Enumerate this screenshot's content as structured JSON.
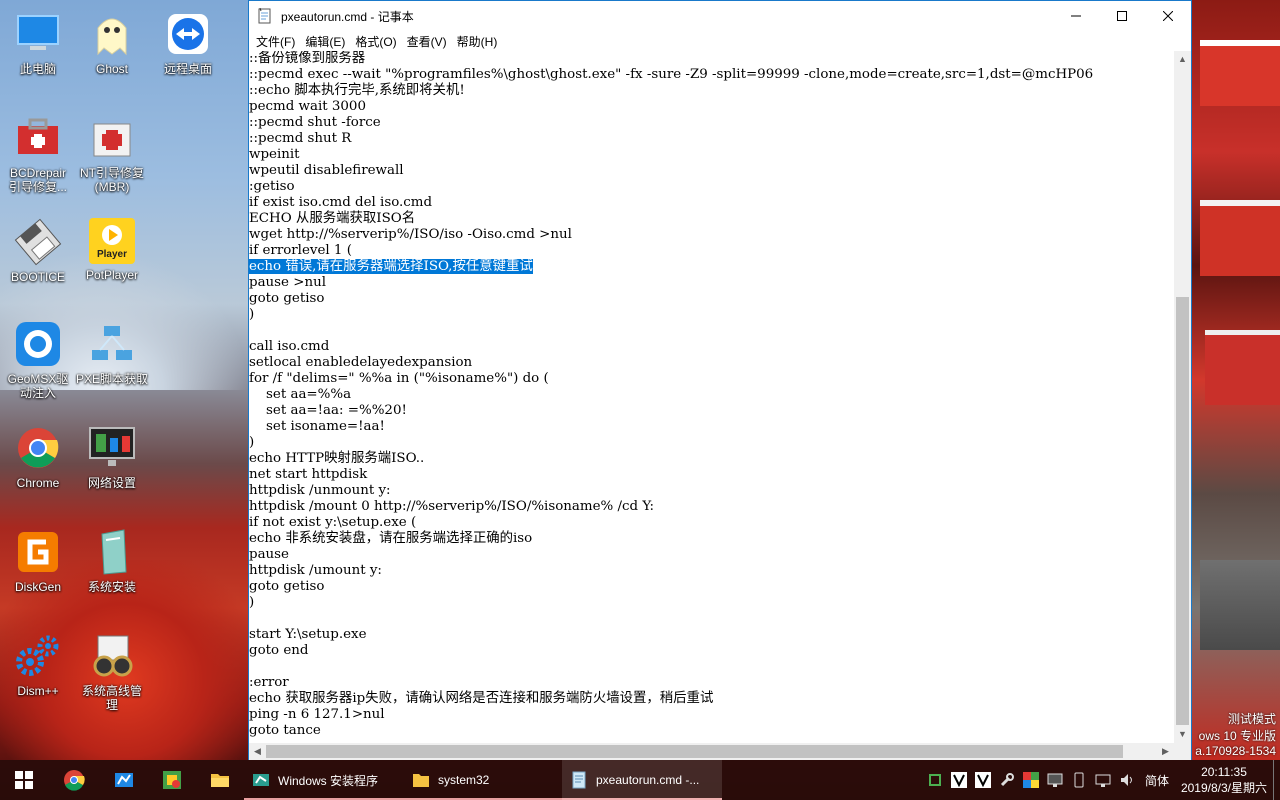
{
  "desktop": {
    "icons": [
      {
        "label": "此电脑"
      },
      {
        "label": "Ghost"
      },
      {
        "label": "远程桌面"
      },
      {
        "label": "BCDrepair\n引导修复..."
      },
      {
        "label": "NT引导修复\n(MBR)"
      },
      {
        "label": "BOOTICE"
      },
      {
        "label": "PotPlayer"
      },
      {
        "label": "GeoMSX驱\n动注入"
      },
      {
        "label": "PXE脚本获取"
      },
      {
        "label": "Chrome"
      },
      {
        "label": "网络设置"
      },
      {
        "label": "DiskGen"
      },
      {
        "label": "系统安装"
      },
      {
        "label": "Dism++"
      },
      {
        "label": "系统高线管\n理"
      }
    ],
    "potplayer_badge": "Player",
    "watermark": {
      "line1": "测试模式",
      "line2": "ows 10 专业版",
      "line3": "a.170928-1534"
    }
  },
  "notepad": {
    "title": "pxeautorun.cmd - 记事本",
    "menu": [
      "文件(F)",
      "编辑(E)",
      "格式(O)",
      "查看(V)",
      "帮助(H)"
    ],
    "lines_before": [
      "::备份镜像到服务器",
      "::pecmd exec --wait \"%programfiles%\\ghost\\ghost.exe\" -fx -sure -Z9 -split=99999 -clone,mode=create,src=1,dst=@mcHP06",
      "::echo 脚本执行完毕,系统即将关机!",
      "pecmd wait 3000",
      "::pecmd shut -force",
      "::pecmd shut R",
      "wpeinit",
      "wpeutil disablefirewall",
      ":getiso",
      "if exist iso.cmd del iso.cmd",
      "ECHO 从服务端获取ISO名",
      "wget http://%serverip%/ISO/iso -Oiso.cmd >nul",
      "if errorlevel 1 ("
    ],
    "selected_line": "echo 错误,请在服务器端选择ISO,按任意键重试",
    "lines_after": [
      "pause >nul",
      "goto getiso",
      ")",
      "",
      "call iso.cmd",
      "setlocal enabledelayedexpansion",
      "for /f \"delims=\" %%a in (\"%isoname%\") do (",
      "    set aa=%%a",
      "    set aa=!aa: =%%20!",
      "    set isoname=!aa!",
      ")",
      "echo HTTP映射服务端ISO..",
      "net start httpdisk",
      "httpdisk /unmount y:",
      "httpdisk /mount 0 http://%serverip%/ISO/%isoname% /cd Y:",
      "if not exist y:\\setup.exe (",
      "echo 非系统安装盘，请在服务端选择正确的iso",
      "pause",
      "httpdisk /umount y:",
      "goto getiso",
      ")",
      "",
      "start Y:\\setup.exe",
      "goto end",
      "",
      ":error",
      "echo 获取服务器ip失败，请确认网络是否连接和服务端防火墙设置，稍后重试",
      "ping -n 6 127.1>nul",
      "goto tance"
    ]
  },
  "taskbar": {
    "tasks": [
      {
        "label": "Windows 安装程序"
      },
      {
        "label": "system32"
      },
      {
        "label": "pxeautorun.cmd -..."
      }
    ],
    "ime": "简体",
    "time": "20:11:35",
    "date": "2019/8/3/星期六"
  },
  "colors": {
    "selection": "#0078d7",
    "window_border": "#1979ca"
  }
}
